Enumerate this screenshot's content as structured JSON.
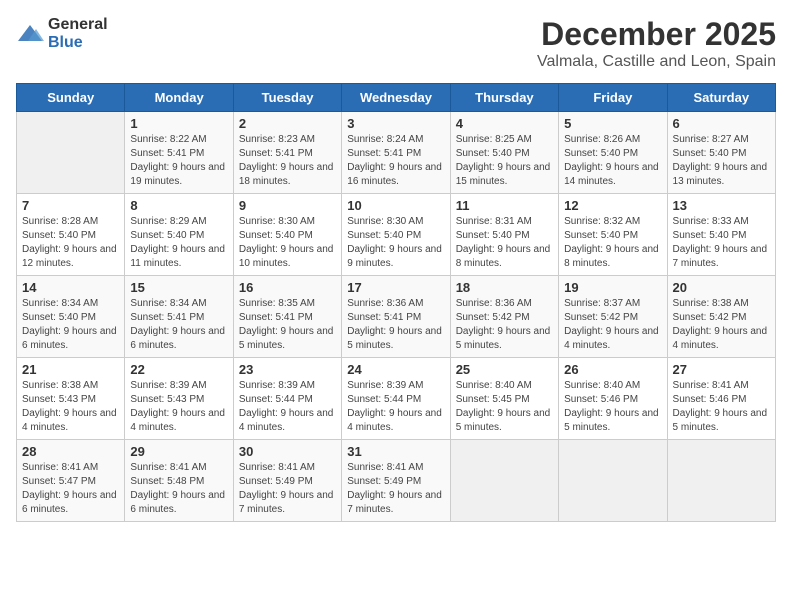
{
  "logo": {
    "general": "General",
    "blue": "Blue"
  },
  "title": "December 2025",
  "subtitle": "Valmala, Castille and Leon, Spain",
  "days_of_week": [
    "Sunday",
    "Monday",
    "Tuesday",
    "Wednesday",
    "Thursday",
    "Friday",
    "Saturday"
  ],
  "weeks": [
    [
      {
        "day": "",
        "sunrise": "",
        "sunset": "",
        "daylight": ""
      },
      {
        "day": "1",
        "sunrise": "Sunrise: 8:22 AM",
        "sunset": "Sunset: 5:41 PM",
        "daylight": "Daylight: 9 hours and 19 minutes."
      },
      {
        "day": "2",
        "sunrise": "Sunrise: 8:23 AM",
        "sunset": "Sunset: 5:41 PM",
        "daylight": "Daylight: 9 hours and 18 minutes."
      },
      {
        "day": "3",
        "sunrise": "Sunrise: 8:24 AM",
        "sunset": "Sunset: 5:41 PM",
        "daylight": "Daylight: 9 hours and 16 minutes."
      },
      {
        "day": "4",
        "sunrise": "Sunrise: 8:25 AM",
        "sunset": "Sunset: 5:40 PM",
        "daylight": "Daylight: 9 hours and 15 minutes."
      },
      {
        "day": "5",
        "sunrise": "Sunrise: 8:26 AM",
        "sunset": "Sunset: 5:40 PM",
        "daylight": "Daylight: 9 hours and 14 minutes."
      },
      {
        "day": "6",
        "sunrise": "Sunrise: 8:27 AM",
        "sunset": "Sunset: 5:40 PM",
        "daylight": "Daylight: 9 hours and 13 minutes."
      }
    ],
    [
      {
        "day": "7",
        "sunrise": "Sunrise: 8:28 AM",
        "sunset": "Sunset: 5:40 PM",
        "daylight": "Daylight: 9 hours and 12 minutes."
      },
      {
        "day": "8",
        "sunrise": "Sunrise: 8:29 AM",
        "sunset": "Sunset: 5:40 PM",
        "daylight": "Daylight: 9 hours and 11 minutes."
      },
      {
        "day": "9",
        "sunrise": "Sunrise: 8:30 AM",
        "sunset": "Sunset: 5:40 PM",
        "daylight": "Daylight: 9 hours and 10 minutes."
      },
      {
        "day": "10",
        "sunrise": "Sunrise: 8:30 AM",
        "sunset": "Sunset: 5:40 PM",
        "daylight": "Daylight: 9 hours and 9 minutes."
      },
      {
        "day": "11",
        "sunrise": "Sunrise: 8:31 AM",
        "sunset": "Sunset: 5:40 PM",
        "daylight": "Daylight: 9 hours and 8 minutes."
      },
      {
        "day": "12",
        "sunrise": "Sunrise: 8:32 AM",
        "sunset": "Sunset: 5:40 PM",
        "daylight": "Daylight: 9 hours and 8 minutes."
      },
      {
        "day": "13",
        "sunrise": "Sunrise: 8:33 AM",
        "sunset": "Sunset: 5:40 PM",
        "daylight": "Daylight: 9 hours and 7 minutes."
      }
    ],
    [
      {
        "day": "14",
        "sunrise": "Sunrise: 8:34 AM",
        "sunset": "Sunset: 5:40 PM",
        "daylight": "Daylight: 9 hours and 6 minutes."
      },
      {
        "day": "15",
        "sunrise": "Sunrise: 8:34 AM",
        "sunset": "Sunset: 5:41 PM",
        "daylight": "Daylight: 9 hours and 6 minutes."
      },
      {
        "day": "16",
        "sunrise": "Sunrise: 8:35 AM",
        "sunset": "Sunset: 5:41 PM",
        "daylight": "Daylight: 9 hours and 5 minutes."
      },
      {
        "day": "17",
        "sunrise": "Sunrise: 8:36 AM",
        "sunset": "Sunset: 5:41 PM",
        "daylight": "Daylight: 9 hours and 5 minutes."
      },
      {
        "day": "18",
        "sunrise": "Sunrise: 8:36 AM",
        "sunset": "Sunset: 5:42 PM",
        "daylight": "Daylight: 9 hours and 5 minutes."
      },
      {
        "day": "19",
        "sunrise": "Sunrise: 8:37 AM",
        "sunset": "Sunset: 5:42 PM",
        "daylight": "Daylight: 9 hours and 4 minutes."
      },
      {
        "day": "20",
        "sunrise": "Sunrise: 8:38 AM",
        "sunset": "Sunset: 5:42 PM",
        "daylight": "Daylight: 9 hours and 4 minutes."
      }
    ],
    [
      {
        "day": "21",
        "sunrise": "Sunrise: 8:38 AM",
        "sunset": "Sunset: 5:43 PM",
        "daylight": "Daylight: 9 hours and 4 minutes."
      },
      {
        "day": "22",
        "sunrise": "Sunrise: 8:39 AM",
        "sunset": "Sunset: 5:43 PM",
        "daylight": "Daylight: 9 hours and 4 minutes."
      },
      {
        "day": "23",
        "sunrise": "Sunrise: 8:39 AM",
        "sunset": "Sunset: 5:44 PM",
        "daylight": "Daylight: 9 hours and 4 minutes."
      },
      {
        "day": "24",
        "sunrise": "Sunrise: 8:39 AM",
        "sunset": "Sunset: 5:44 PM",
        "daylight": "Daylight: 9 hours and 4 minutes."
      },
      {
        "day": "25",
        "sunrise": "Sunrise: 8:40 AM",
        "sunset": "Sunset: 5:45 PM",
        "daylight": "Daylight: 9 hours and 5 minutes."
      },
      {
        "day": "26",
        "sunrise": "Sunrise: 8:40 AM",
        "sunset": "Sunset: 5:46 PM",
        "daylight": "Daylight: 9 hours and 5 minutes."
      },
      {
        "day": "27",
        "sunrise": "Sunrise: 8:41 AM",
        "sunset": "Sunset: 5:46 PM",
        "daylight": "Daylight: 9 hours and 5 minutes."
      }
    ],
    [
      {
        "day": "28",
        "sunrise": "Sunrise: 8:41 AM",
        "sunset": "Sunset: 5:47 PM",
        "daylight": "Daylight: 9 hours and 6 minutes."
      },
      {
        "day": "29",
        "sunrise": "Sunrise: 8:41 AM",
        "sunset": "Sunset: 5:48 PM",
        "daylight": "Daylight: 9 hours and 6 minutes."
      },
      {
        "day": "30",
        "sunrise": "Sunrise: 8:41 AM",
        "sunset": "Sunset: 5:49 PM",
        "daylight": "Daylight: 9 hours and 7 minutes."
      },
      {
        "day": "31",
        "sunrise": "Sunrise: 8:41 AM",
        "sunset": "Sunset: 5:49 PM",
        "daylight": "Daylight: 9 hours and 7 minutes."
      },
      {
        "day": "",
        "sunrise": "",
        "sunset": "",
        "daylight": ""
      },
      {
        "day": "",
        "sunrise": "",
        "sunset": "",
        "daylight": ""
      },
      {
        "day": "",
        "sunrise": "",
        "sunset": "",
        "daylight": ""
      }
    ]
  ]
}
